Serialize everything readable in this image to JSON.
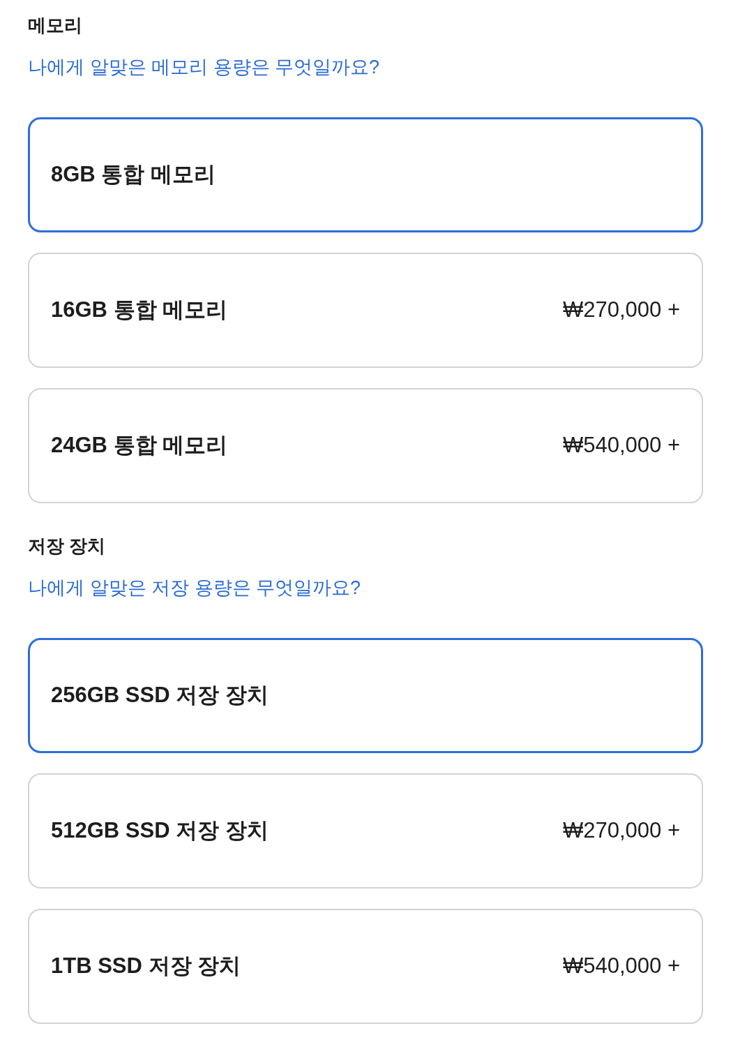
{
  "sections": [
    {
      "title": "메모리",
      "help_link": "나에게 알맞은 메모리 용량은 무엇일까요?",
      "options": [
        {
          "label": "8GB 통합 메모리",
          "selected": true
        },
        {
          "label": "16GB 통합 메모리",
          "price": "₩270,000 +",
          "selected": false
        },
        {
          "label": "24GB 통합 메모리",
          "price": "₩540,000 +",
          "selected": false
        }
      ]
    },
    {
      "title": "저장 장치",
      "help_link": "나에게 알맞은 저장 용량은 무엇일까요?",
      "options": [
        {
          "label": "256GB SSD 저장 장치",
          "selected": true
        },
        {
          "label": "512GB SSD 저장 장치",
          "price": "₩270,000 +",
          "selected": false
        },
        {
          "label": "1TB SSD 저장 장치",
          "price": "₩540,000 +",
          "selected": false
        }
      ]
    }
  ]
}
